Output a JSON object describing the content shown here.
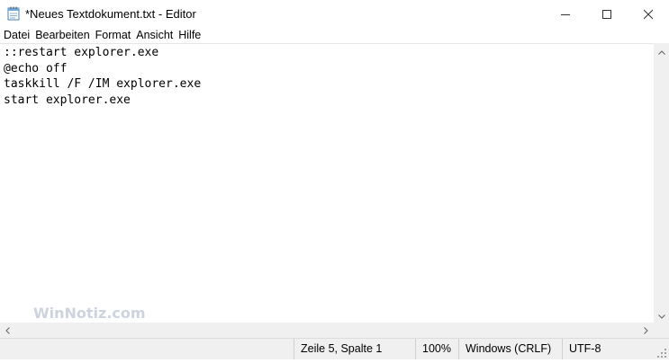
{
  "window": {
    "title": "*Neues Textdokument.txt - Editor"
  },
  "icons": {
    "app": "notepad-icon",
    "minimize": "minimize-icon",
    "maximize": "maximize-icon",
    "close": "close-icon"
  },
  "menu": {
    "items": [
      {
        "label": "Datei"
      },
      {
        "label": "Bearbeiten"
      },
      {
        "label": "Format"
      },
      {
        "label": "Ansicht"
      },
      {
        "label": "Hilfe"
      }
    ]
  },
  "editor": {
    "content": "::restart explorer.exe\n@echo off\ntaskkill /F /IM explorer.exe\nstart explorer.exe"
  },
  "watermark": {
    "text": "WinNotiz.com"
  },
  "statusbar": {
    "position": "Zeile 5, Spalte 1",
    "zoom": "100%",
    "line_ending": "Windows (CRLF)",
    "encoding": "UTF-8"
  },
  "colors": {
    "watermark": "#cdd3df",
    "scrollbar": "#f0f0f0",
    "statusbar": "#f0f0f0"
  }
}
